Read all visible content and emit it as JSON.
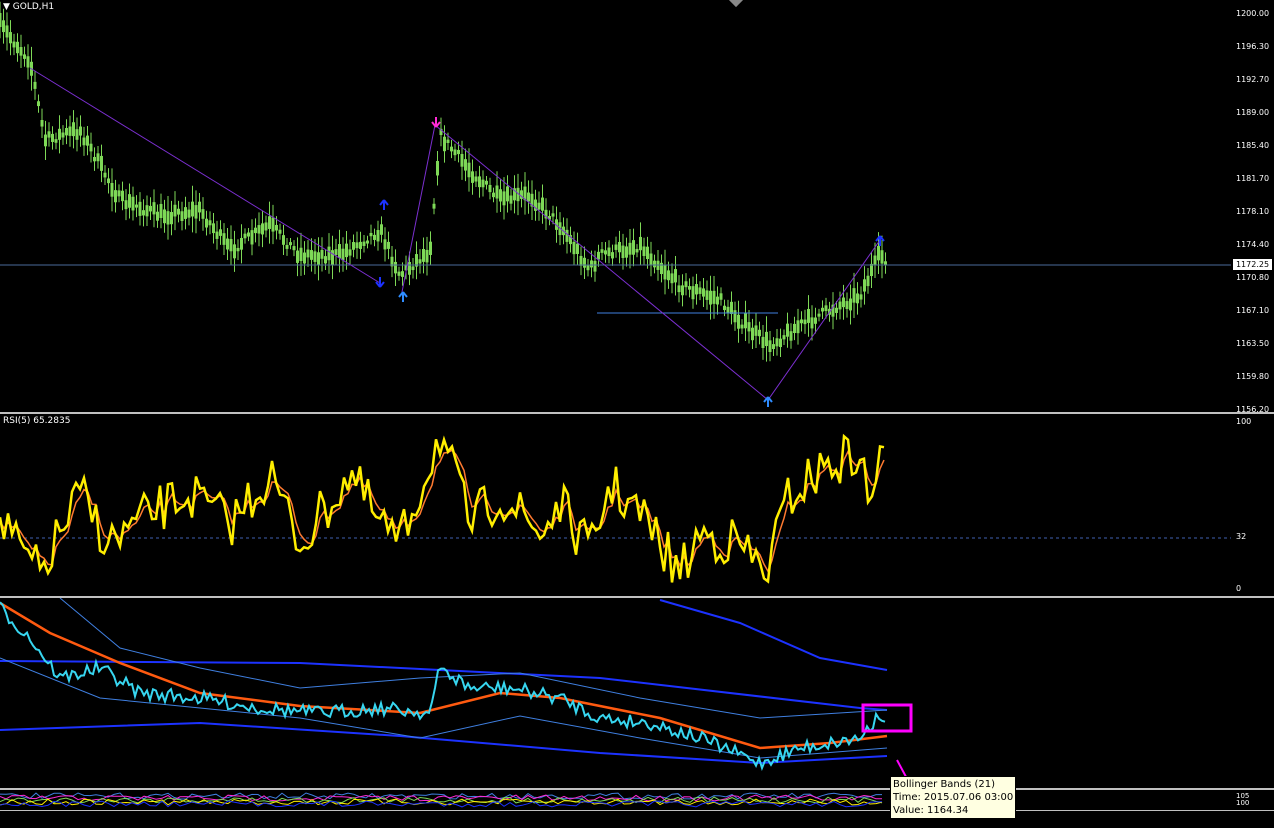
{
  "main": {
    "symbol_label": "GOLD,H1",
    "price_ticks": [
      "1200.00",
      "1196.30",
      "1192.70",
      "1189.00",
      "1185.40",
      "1181.70",
      "1178.10",
      "1174.40",
      "1170.80",
      "1167.10",
      "1163.50",
      "1159.80",
      "1156.20"
    ],
    "current_price": "1172.25"
  },
  "rsi": {
    "label": "RSI(5) 65.2835",
    "ticks": [
      "100",
      "32",
      "0"
    ]
  },
  "bottom": {
    "ticks": [
      "105",
      "100"
    ]
  },
  "tooltip": {
    "line1": "Bollinger Bands (21)",
    "line2": "Time: 2015.07.06 03:00",
    "line3": "Value: 1164.34"
  },
  "colors": {
    "candle": "#7ed957",
    "arrow_up": "#2f8cff",
    "arrow_down": "#ff2bd6",
    "zigzag": "#7b2fd0",
    "rsi_main": "#ffee00",
    "rsi_signal": "#ff7a30",
    "price_line": "#37d6f0",
    "ma_line": "#ff5a10",
    "band_outer": "#1c32ff",
    "band_inner": "#3f7fe0",
    "highlight_box": "#ff00ff"
  }
}
